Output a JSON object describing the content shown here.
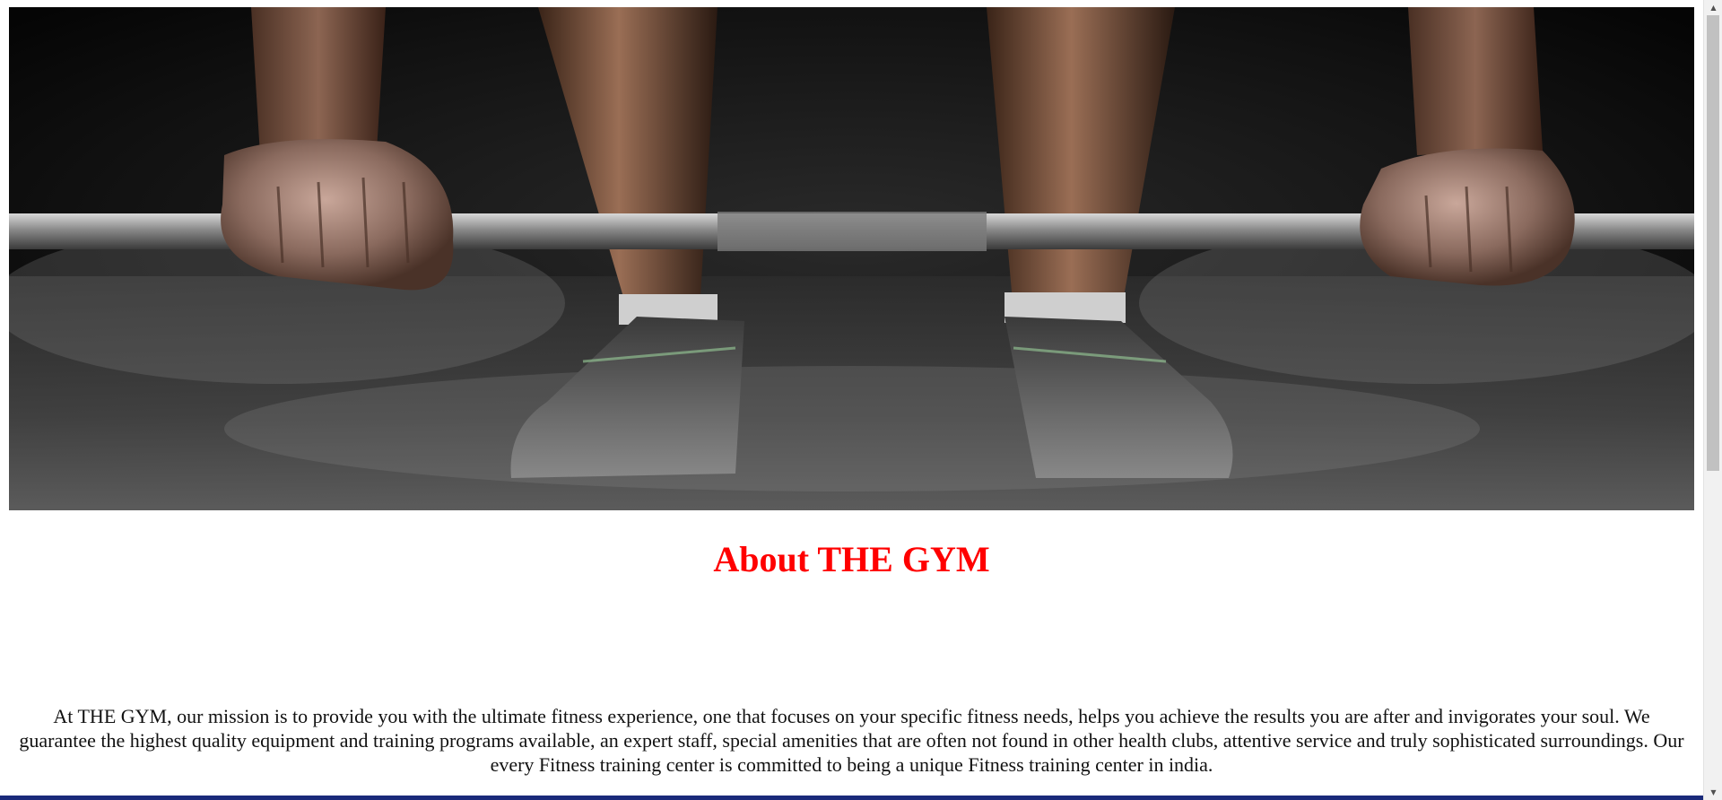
{
  "hero": {
    "image": "weightlifter-gripping-barbell-photo",
    "alt_colors": {
      "background": "#0c0c0c",
      "skin": "#7a5a48",
      "bar": "#9a9a9a"
    }
  },
  "about": {
    "title": "About THE GYM",
    "title_color": "#ff0000",
    "mission": "At THE GYM, our mission is to provide you with the ultimate fitness experience, one that focuses on your specific fitness needs, helps you achieve the results you are after and invigorates your soul. We guarantee the highest quality equipment and training programs available, an expert staff, special amenities that are often not found in other health clubs, attentive service and truly sophisticated surroundings. Our every Fitness training center is committed to being a unique Fitness training center in india."
  },
  "scrollbar": {
    "up_icon": "scroll-up-arrow-icon",
    "down_icon": "scroll-down-arrow-icon"
  },
  "colors": {
    "bottom_bar": "#1a2a7a"
  }
}
